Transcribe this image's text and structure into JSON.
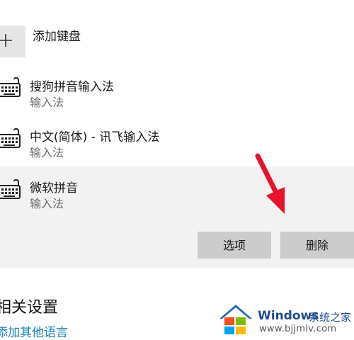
{
  "add_keyboard": {
    "plus_icon": "plus-icon",
    "label": "添加键盘"
  },
  "keyboards": [
    {
      "name": "搜狗拼音输入法",
      "type": "输入法"
    },
    {
      "name": "中文(简体) - 讯飞输入法",
      "type": "输入法"
    },
    {
      "name": "微软拼音",
      "type": "输入法",
      "selected": true
    }
  ],
  "actions": {
    "options": "选项",
    "remove": "删除"
  },
  "related": {
    "heading": "相关设置",
    "add_language": "添加其他语言"
  },
  "watermark": {
    "brand": "Windows",
    "suffix": "系统之家",
    "url": "www.bjjmlv.com"
  },
  "colors": {
    "accent_link": "#1a7fb8",
    "arrow": "#e8132b",
    "panel": "#f2f2f2",
    "button": "#cccccc"
  }
}
